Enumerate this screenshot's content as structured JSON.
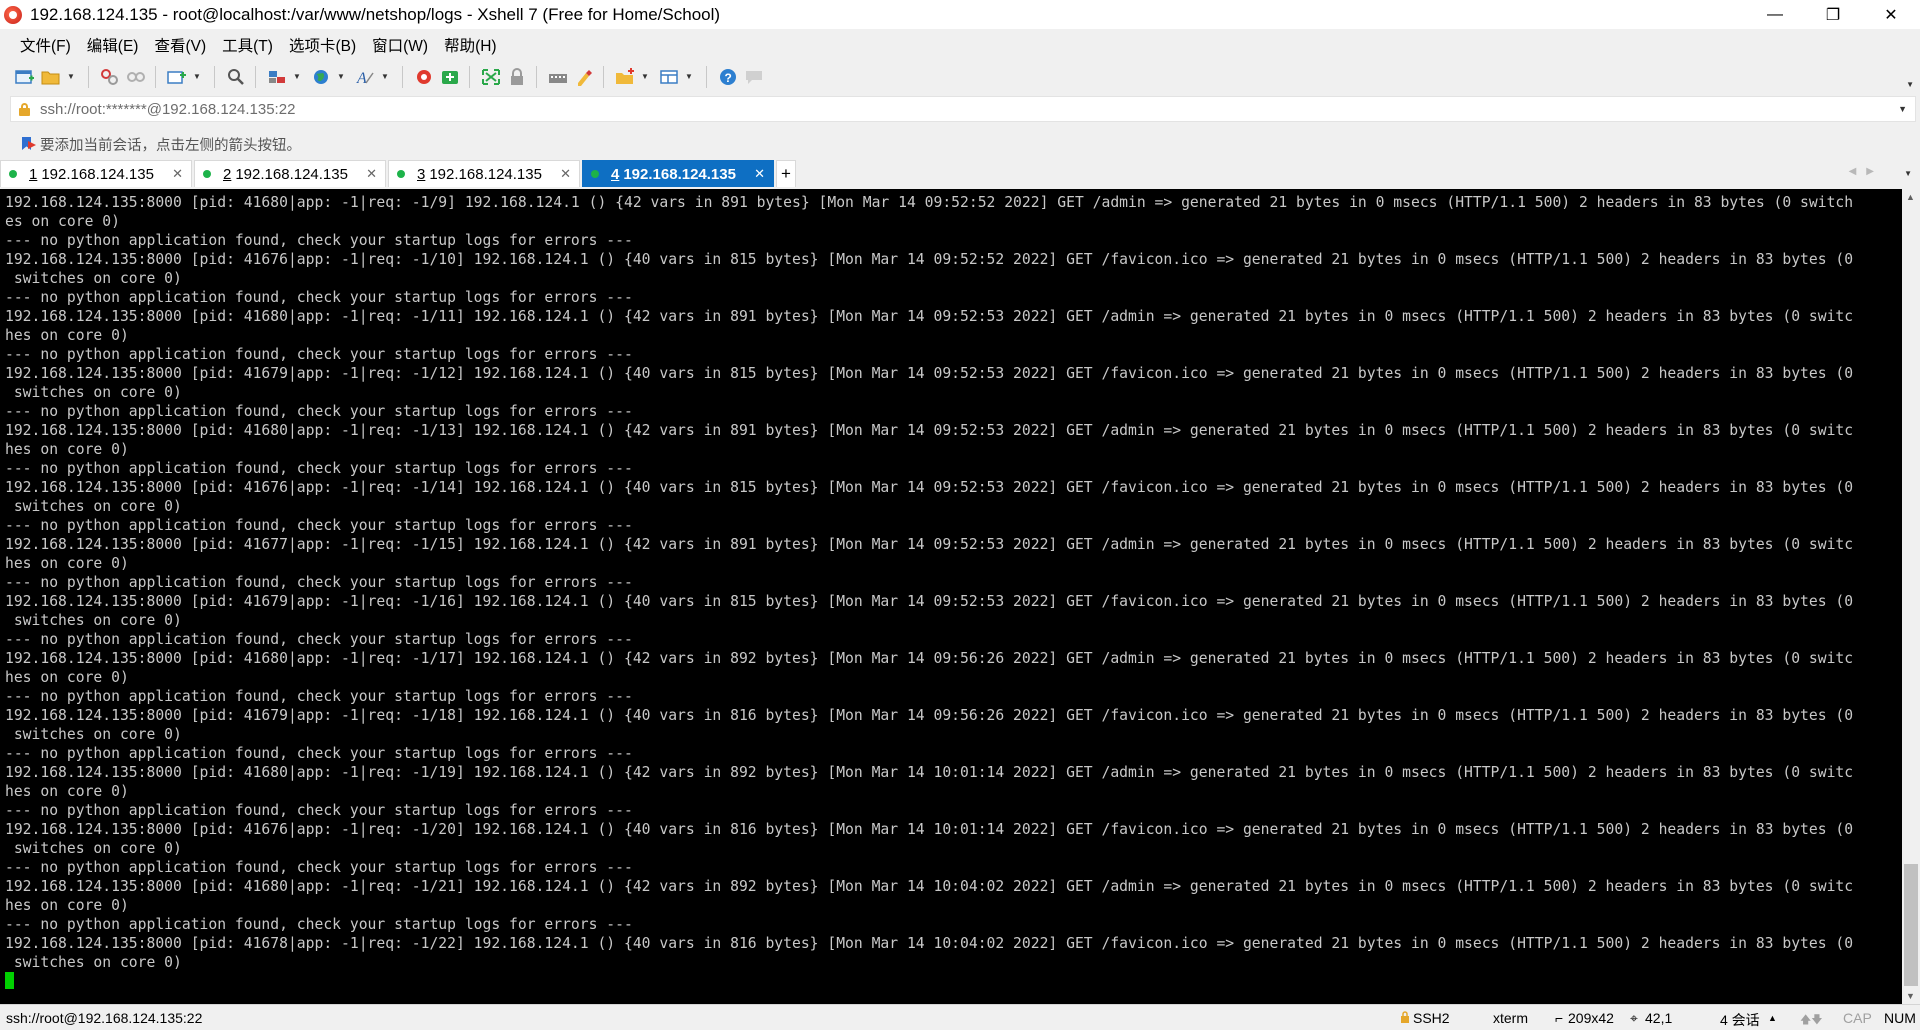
{
  "window": {
    "title": "192.168.124.135 - root@localhost:/var/www/netshop/logs - Xshell 7 (Free for Home/School)",
    "minimize": "—",
    "maximize": "❐",
    "close": "✕"
  },
  "menu": [
    "文件(F)",
    "编辑(E)",
    "查看(V)",
    "工具(T)",
    "选项卡(B)",
    "窗口(W)",
    "帮助(H)"
  ],
  "address": {
    "text": "ssh://root:*******@192.168.124.135:22"
  },
  "hint": {
    "text": "要添加当前会话，点击左侧的箭头按钮。"
  },
  "tabs": [
    {
      "num": "1",
      "label": "192.168.124.135",
      "active": false
    },
    {
      "num": "2",
      "label": "192.168.124.135",
      "active": false
    },
    {
      "num": "3",
      "label": "192.168.124.135",
      "active": false
    },
    {
      "num": "4",
      "label": "192.168.124.135",
      "active": true
    }
  ],
  "terminal": {
    "lines": [
      "192.168.124.135:8000 [pid: 41680|app: -1|req: -1/9] 192.168.124.1 () {42 vars in 891 bytes} [Mon Mar 14 09:52:52 2022] GET /admin => generated 21 bytes in 0 msecs (HTTP/1.1 500) 2 headers in 83 bytes (0 switch",
      "es on core 0)",
      "--- no python application found, check your startup logs for errors ---",
      "192.168.124.135:8000 [pid: 41676|app: -1|req: -1/10] 192.168.124.1 () {40 vars in 815 bytes} [Mon Mar 14 09:52:52 2022] GET /favicon.ico => generated 21 bytes in 0 msecs (HTTP/1.1 500) 2 headers in 83 bytes (0",
      " switches on core 0)",
      "--- no python application found, check your startup logs for errors ---",
      "192.168.124.135:8000 [pid: 41680|app: -1|req: -1/11] 192.168.124.1 () {42 vars in 891 bytes} [Mon Mar 14 09:52:53 2022] GET /admin => generated 21 bytes in 0 msecs (HTTP/1.1 500) 2 headers in 83 bytes (0 switc",
      "hes on core 0)",
      "--- no python application found, check your startup logs for errors ---",
      "192.168.124.135:8000 [pid: 41679|app: -1|req: -1/12] 192.168.124.1 () {40 vars in 815 bytes} [Mon Mar 14 09:52:53 2022] GET /favicon.ico => generated 21 bytes in 0 msecs (HTTP/1.1 500) 2 headers in 83 bytes (0",
      " switches on core 0)",
      "--- no python application found, check your startup logs for errors ---",
      "192.168.124.135:8000 [pid: 41680|app: -1|req: -1/13] 192.168.124.1 () {42 vars in 891 bytes} [Mon Mar 14 09:52:53 2022] GET /admin => generated 21 bytes in 0 msecs (HTTP/1.1 500) 2 headers in 83 bytes (0 switc",
      "hes on core 0)",
      "--- no python application found, check your startup logs for errors ---",
      "192.168.124.135:8000 [pid: 41676|app: -1|req: -1/14] 192.168.124.1 () {40 vars in 815 bytes} [Mon Mar 14 09:52:53 2022] GET /favicon.ico => generated 21 bytes in 0 msecs (HTTP/1.1 500) 2 headers in 83 bytes (0",
      " switches on core 0)",
      "--- no python application found, check your startup logs for errors ---",
      "192.168.124.135:8000 [pid: 41677|app: -1|req: -1/15] 192.168.124.1 () {42 vars in 891 bytes} [Mon Mar 14 09:52:53 2022] GET /admin => generated 21 bytes in 0 msecs (HTTP/1.1 500) 2 headers in 83 bytes (0 switc",
      "hes on core 0)",
      "--- no python application found, check your startup logs for errors ---",
      "192.168.124.135:8000 [pid: 41679|app: -1|req: -1/16] 192.168.124.1 () {40 vars in 815 bytes} [Mon Mar 14 09:52:53 2022] GET /favicon.ico => generated 21 bytes in 0 msecs (HTTP/1.1 500) 2 headers in 83 bytes (0",
      " switches on core 0)",
      "--- no python application found, check your startup logs for errors ---",
      "192.168.124.135:8000 [pid: 41680|app: -1|req: -1/17] 192.168.124.1 () {42 vars in 892 bytes} [Mon Mar 14 09:56:26 2022] GET /admin => generated 21 bytes in 0 msecs (HTTP/1.1 500) 2 headers in 83 bytes (0 switc",
      "hes on core 0)",
      "--- no python application found, check your startup logs for errors ---",
      "192.168.124.135:8000 [pid: 41679|app: -1|req: -1/18] 192.168.124.1 () {40 vars in 816 bytes} [Mon Mar 14 09:56:26 2022] GET /favicon.ico => generated 21 bytes in 0 msecs (HTTP/1.1 500) 2 headers in 83 bytes (0",
      " switches on core 0)",
      "--- no python application found, check your startup logs for errors ---",
      "192.168.124.135:8000 [pid: 41680|app: -1|req: -1/19] 192.168.124.1 () {42 vars in 892 bytes} [Mon Mar 14 10:01:14 2022] GET /admin => generated 21 bytes in 0 msecs (HTTP/1.1 500) 2 headers in 83 bytes (0 switc",
      "hes on core 0)",
      "--- no python application found, check your startup logs for errors ---",
      "192.168.124.135:8000 [pid: 41676|app: -1|req: -1/20] 192.168.124.1 () {40 vars in 816 bytes} [Mon Mar 14 10:01:14 2022] GET /favicon.ico => generated 21 bytes in 0 msecs (HTTP/1.1 500) 2 headers in 83 bytes (0",
      " switches on core 0)",
      "--- no python application found, check your startup logs for errors ---",
      "192.168.124.135:8000 [pid: 41680|app: -1|req: -1/21] 192.168.124.1 () {42 vars in 892 bytes} [Mon Mar 14 10:04:02 2022] GET /admin => generated 21 bytes in 0 msecs (HTTP/1.1 500) 2 headers in 83 bytes (0 switc",
      "hes on core 0)",
      "--- no python application found, check your startup logs for errors ---",
      "192.168.124.135:8000 [pid: 41678|app: -1|req: -1/22] 192.168.124.1 () {40 vars in 816 bytes} [Mon Mar 14 10:04:02 2022] GET /favicon.ico => generated 21 bytes in 0 msecs (HTTP/1.1 500) 2 headers in 83 bytes (0",
      " switches on core 0)"
    ]
  },
  "status": {
    "connection": "ssh://root@192.168.124.135:22",
    "protocol": "SSH2",
    "terminal_type": "xterm",
    "size": "209x42",
    "cursor_pos": "42,1",
    "sessions": "4 会话",
    "caps": "CAP",
    "num": "NUM"
  },
  "colors": {
    "active_tab": "#0e6fc3",
    "session_dot": "#1db34a",
    "terminal_bg": "#000000",
    "terminal_fg": "#c8c8c8",
    "cursor": "#00d000"
  },
  "icons": [
    "new-session-icon",
    "open-folder-icon",
    "connect-icon",
    "disconnect-icon",
    "new-tab-icon",
    "find-icon",
    "properties-icon",
    "globe-icon",
    "font-icon",
    "xshell-icon",
    "xftp-icon",
    "fullscreen-icon",
    "lock-icon",
    "keyboard-icon",
    "highlight-icon",
    "compose-icon",
    "layout-icon",
    "help-icon",
    "chat-icon"
  ]
}
